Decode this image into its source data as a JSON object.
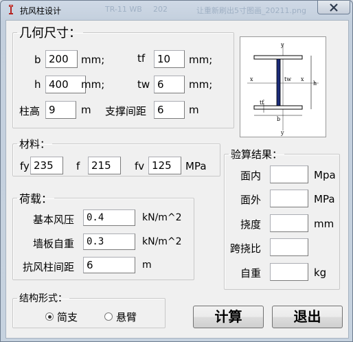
{
  "window": {
    "title": "抗风柱设计",
    "background_ghost_text": [
      "TR-11 WB",
      "202",
      "让重新刷出5寸图画_20211.png"
    ]
  },
  "geometry": {
    "legend": "几何尺寸：",
    "b": {
      "label": "b",
      "value": "200",
      "unit": "mm;"
    },
    "tf": {
      "label": "tf",
      "value": "10",
      "unit": "mm;"
    },
    "h": {
      "label": "h",
      "value": "400",
      "unit": "mm;"
    },
    "tw": {
      "label": "tw",
      "value": "6",
      "unit": "mm;"
    },
    "height": {
      "label": "柱高",
      "value": "9",
      "unit": "m"
    },
    "brace": {
      "label": "支撑间距",
      "value": "6",
      "unit": "m"
    }
  },
  "diagram": {
    "y_top": "y",
    "y_bottom": "y",
    "x_left": "x",
    "x_right": "x",
    "tw": "tw",
    "tf": "tf",
    "h": "h",
    "b": "b"
  },
  "material": {
    "legend": "材料：",
    "fy": {
      "label": "fy",
      "value": "235"
    },
    "f": {
      "label": "f",
      "value": "215"
    },
    "fv": {
      "label": "fv",
      "value": "125"
    },
    "unit": "MPa"
  },
  "load": {
    "legend": "荷载：",
    "wind": {
      "label": "基本风压",
      "value": "0.4",
      "unit": "kN/m^2"
    },
    "wall": {
      "label": "墙板自重",
      "value": "0.3",
      "unit": "kN/m^2"
    },
    "spacing": {
      "label": "抗风柱间距",
      "value": "6",
      "unit": "m"
    }
  },
  "structure": {
    "legend": "结构形式：",
    "options": [
      "简支",
      "悬臂"
    ],
    "selected": "简支"
  },
  "results": {
    "legend": "验算结果：",
    "rows": [
      {
        "label": "面内",
        "value": "",
        "unit": "Mpa"
      },
      {
        "label": "面外",
        "value": "",
        "unit": "MPa"
      },
      {
        "label": "挠度",
        "value": "",
        "unit": "mm"
      },
      {
        "label": "跨挠比",
        "value": "",
        "unit": ""
      },
      {
        "label": "自重",
        "value": "",
        "unit": "kg"
      }
    ]
  },
  "buttons": {
    "calc": "计算",
    "exit": "退出"
  }
}
